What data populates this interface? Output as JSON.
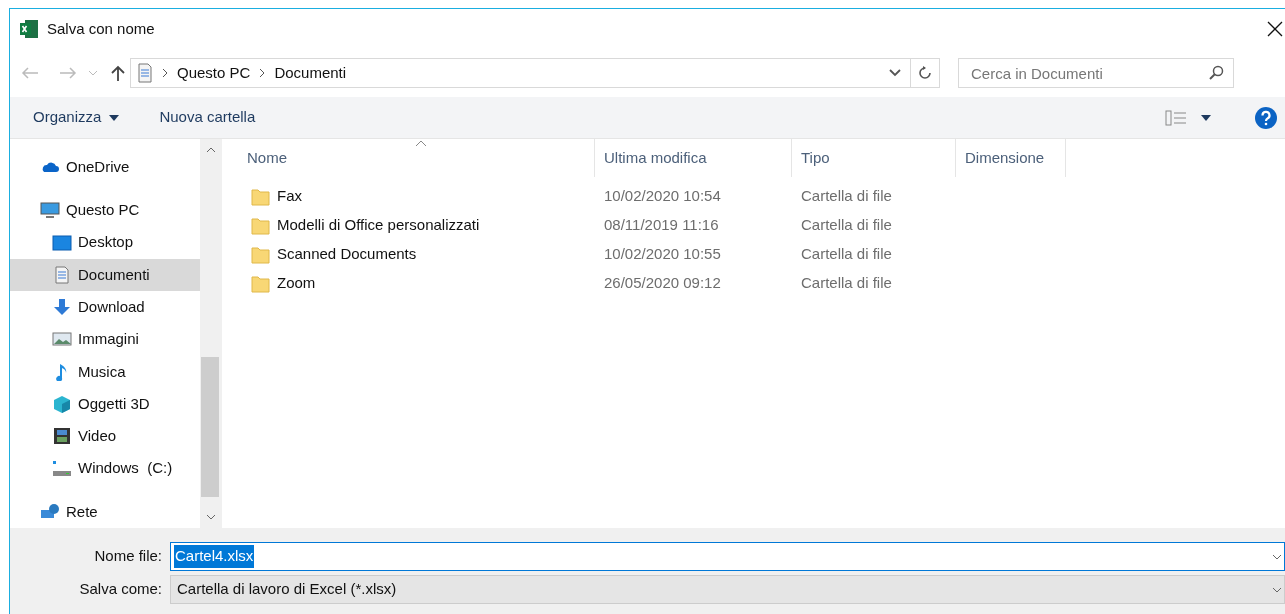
{
  "window": {
    "title": "Salva con nome"
  },
  "breadcrumb": [
    "Questo PC",
    "Documenti"
  ],
  "search": {
    "placeholder": "Cerca in Documenti"
  },
  "toolbar": {
    "organize": "Organizza",
    "new_folder": "Nuova cartella"
  },
  "sidebar": {
    "items": [
      {
        "label": "OneDrive",
        "kind": "cloud",
        "selected": false
      },
      {
        "label": "Questo PC",
        "kind": "pc",
        "selected": false,
        "children": [
          {
            "label": "Desktop",
            "kind": "desktop",
            "selected": false
          },
          {
            "label": "Documenti",
            "kind": "documents",
            "selected": true
          },
          {
            "label": "Download",
            "kind": "download",
            "selected": false
          },
          {
            "label": "Immagini",
            "kind": "images",
            "selected": false
          },
          {
            "label": "Musica",
            "kind": "music",
            "selected": false
          },
          {
            "label": "Oggetti 3D",
            "kind": "cube",
            "selected": false
          },
          {
            "label": "Video",
            "kind": "video",
            "selected": false
          },
          {
            "label": "Windows  (C:)",
            "kind": "drive",
            "selected": false
          }
        ]
      },
      {
        "label": "Rete",
        "kind": "network",
        "selected": false
      }
    ]
  },
  "table": {
    "columns": [
      "Nome",
      "Ultima modifica",
      "Tipo",
      "Dimensione"
    ],
    "rows": [
      {
        "name": "Fax",
        "modified": "10/02/2020 10:54",
        "type": "Cartella di file"
      },
      {
        "name": "Modelli di Office personalizzati",
        "modified": "08/11/2019 11:16",
        "type": "Cartella di file"
      },
      {
        "name": "Scanned Documents",
        "modified": "10/02/2020 10:55",
        "type": "Cartella di file"
      },
      {
        "name": "Zoom",
        "modified": "26/05/2020 09:12",
        "type": "Cartella di file"
      }
    ]
  },
  "form": {
    "filename_label": "Nome file:",
    "filename": "Cartel4.xlsx",
    "save_as_label": "Salva come:",
    "save_as": "Cartella di lavoro di Excel (*.xlsx)"
  }
}
